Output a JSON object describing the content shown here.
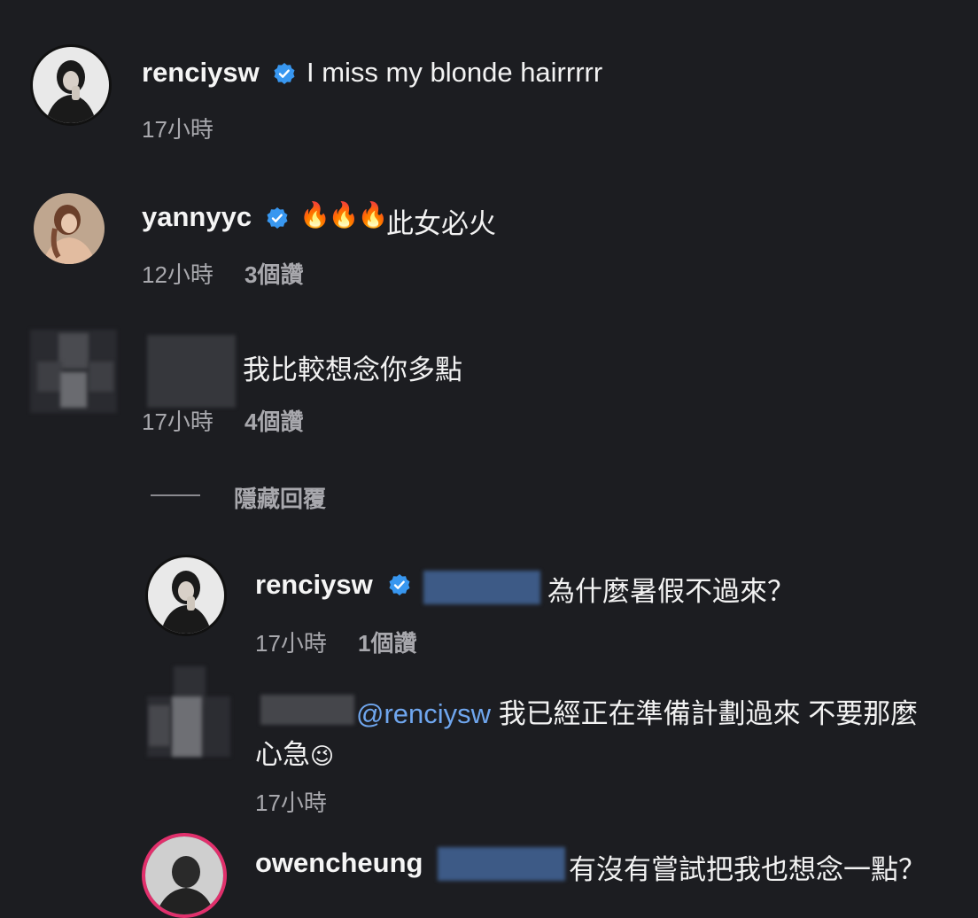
{
  "comments": [
    {
      "username": "renciysw",
      "text": "I miss my blonde hairrrrr",
      "time": "17小時"
    },
    {
      "username": "yannyyc",
      "fire_emoji": "🔥🔥🔥",
      "text": "此女必火",
      "time": "12小時",
      "likes": "3個讚"
    },
    {
      "text": "我比較想念你多點",
      "time": "17小時",
      "likes": "4個讚"
    }
  ],
  "hide_replies": "隱藏回覆",
  "replies": [
    {
      "username": "renciysw",
      "text": "為什麼暑假不過來？",
      "time": "17小時",
      "likes": "1個讚"
    },
    {
      "mention": "@renciysw",
      "text_line1": "我已經正在準備計劃過來 不要那麼",
      "text_line2": "心急",
      "emoji": "😉",
      "time": "17小時"
    },
    {
      "username": "owencheung",
      "text": "有沒有嘗試把我也想念一點？"
    }
  ],
  "colors": {
    "background": "#1c1d21",
    "verified": "#3897f0",
    "mention": "#6fa6ee",
    "story_ring": "#e1306c"
  }
}
